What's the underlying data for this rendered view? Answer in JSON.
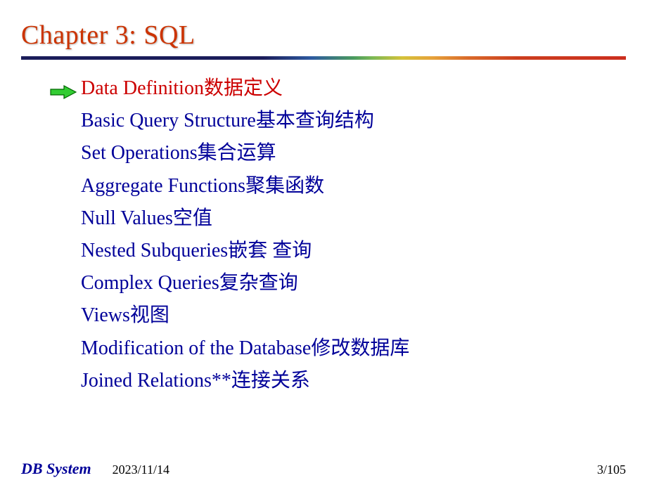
{
  "title": "Chapter 3:  SQL",
  "items": [
    {
      "en": "Data Definition   ",
      "zh": "数据定义",
      "active": true
    },
    {
      "en": "Basic Query Structure  ",
      "zh": "基本查询结构",
      "active": false
    },
    {
      "en": "Set Operations    ",
      "zh": "集合运算",
      "active": false
    },
    {
      "en": "Aggregate Functions   ",
      "zh": "聚集函数",
      "active": false
    },
    {
      "en": "Null Values",
      "zh": "空值",
      "active": false
    },
    {
      "en": "Nested Subqueries",
      "zh": "嵌套 查询",
      "active": false
    },
    {
      "en": "Complex Queries  ",
      "zh": "复杂查询",
      "active": false
    },
    {
      "en": "Views  ",
      "zh": "视图",
      "active": false
    },
    {
      "en": "Modification of the Database  ",
      "zh": "修改数据库",
      "active": false
    },
    {
      "en": "Joined Relations**   ",
      "zh": "连接关系",
      "active": false
    }
  ],
  "footer": {
    "label": "DB System",
    "date": "2023/11/14",
    "page": "3/105"
  }
}
